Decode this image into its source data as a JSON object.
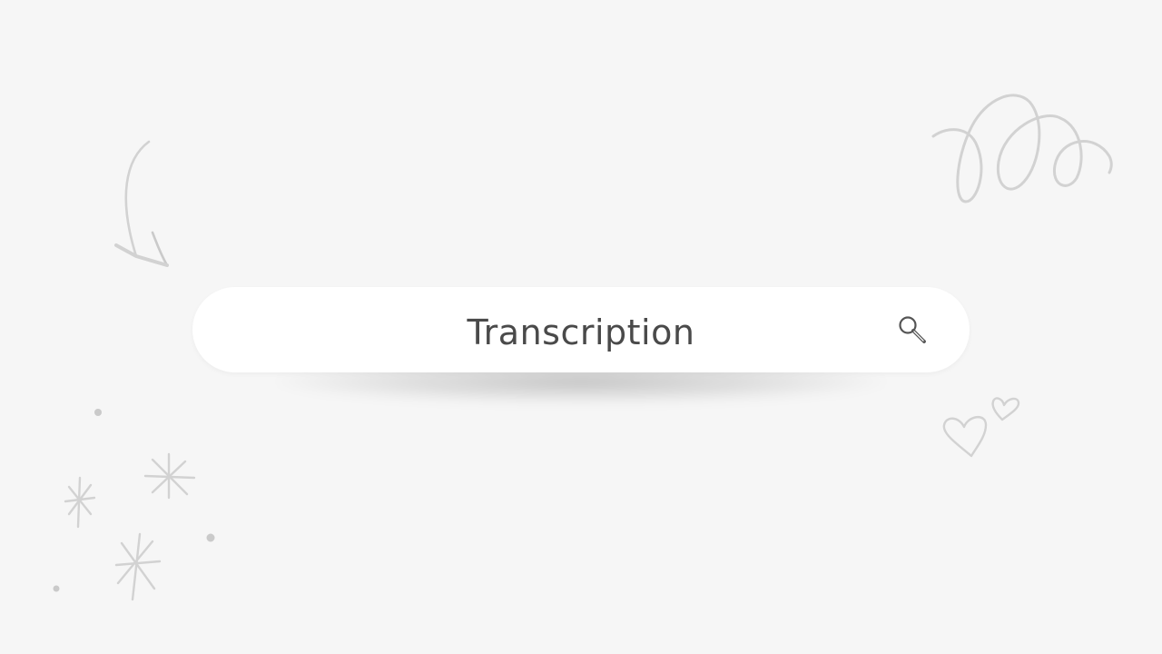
{
  "search": {
    "value": "Transcription",
    "icon": "search-icon"
  },
  "colors": {
    "background": "#f6f6f6",
    "bar": "#ffffff",
    "text": "#4a4a4a",
    "doodle": "#d2d2d2",
    "doodle_dark": "#cacaca",
    "icon": "#555555"
  },
  "decorations": {
    "icons": [
      "curved-arrow-icon",
      "swirl-loops-icon",
      "hearts-icon",
      "sparkles-icon"
    ]
  }
}
